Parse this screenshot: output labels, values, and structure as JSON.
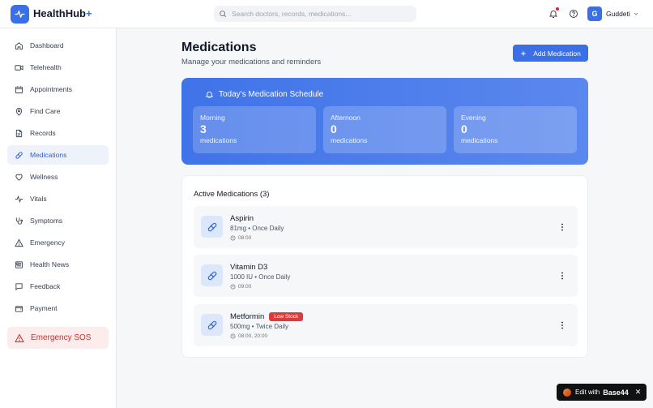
{
  "app": {
    "name": "HealthHub",
    "name_suffix": "+"
  },
  "search": {
    "placeholder": "Search doctors, records, medications..."
  },
  "user": {
    "initial": "G",
    "name": "Guddeti"
  },
  "sidebar": {
    "items": [
      {
        "label": "Dashboard",
        "icon": "home-icon"
      },
      {
        "label": "Telehealth",
        "icon": "video-icon"
      },
      {
        "label": "Appointments",
        "icon": "calendar-icon"
      },
      {
        "label": "Find Care",
        "icon": "map-pin-icon"
      },
      {
        "label": "Records",
        "icon": "file-icon"
      },
      {
        "label": "Medications",
        "icon": "pill-icon",
        "active": true
      },
      {
        "label": "Wellness",
        "icon": "heart-icon"
      },
      {
        "label": "Vitals",
        "icon": "activity-icon"
      },
      {
        "label": "Symptoms",
        "icon": "stethoscope-icon"
      },
      {
        "label": "Emergency",
        "icon": "alert-triangle-icon"
      },
      {
        "label": "Health News",
        "icon": "newspaper-icon"
      },
      {
        "label": "Feedback",
        "icon": "message-icon"
      },
      {
        "label": "Payment",
        "icon": "wallet-icon"
      }
    ],
    "sos_label": "Emergency SOS"
  },
  "page": {
    "title": "Medications",
    "subtitle": "Manage your medications and reminders",
    "add_button": "Add Medication"
  },
  "schedule": {
    "title": "Today's Medication Schedule",
    "slots": [
      {
        "label": "Morning",
        "count": "3",
        "unit": "medications"
      },
      {
        "label": "Afternoon",
        "count": "0",
        "unit": "medications"
      },
      {
        "label": "Evening",
        "count": "0",
        "unit": "medications"
      }
    ]
  },
  "active": {
    "title": "Active Medications (3)",
    "items": [
      {
        "name": "Aspirin",
        "dose": "81mg • Once Daily",
        "time": "08:00",
        "badge": ""
      },
      {
        "name": "Vitamin D3",
        "dose": "1000 IU • Once Daily",
        "time": "09:00",
        "badge": ""
      },
      {
        "name": "Metformin",
        "dose": "500mg • Twice Daily",
        "time": "08:00, 20:00",
        "badge": "Low Stock"
      }
    ]
  },
  "edit_bar": {
    "prefix": "Edit with",
    "brand": "Base44",
    "close": "✕"
  },
  "colors": {
    "accent": "#3b6fe6",
    "danger": "#dc3b3b",
    "sos_bg": "#fdecec"
  }
}
